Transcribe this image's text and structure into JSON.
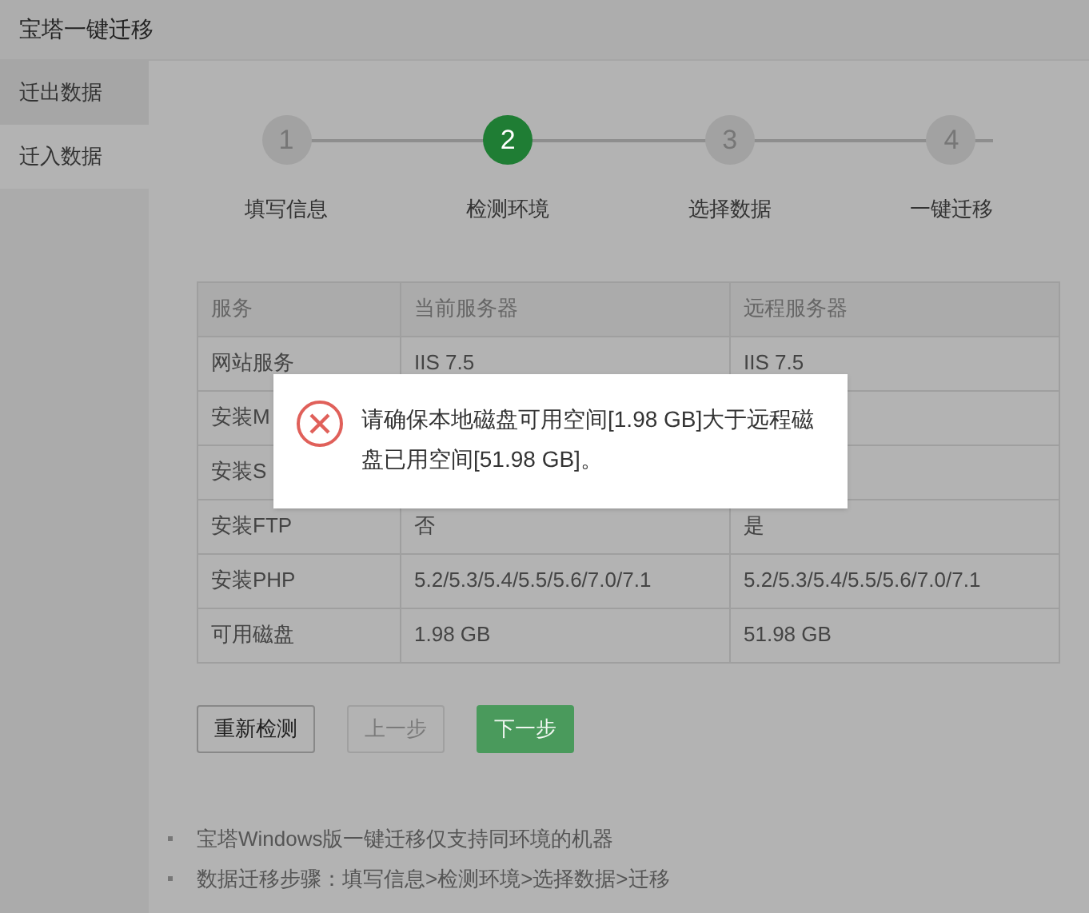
{
  "window": {
    "title": "宝塔一键迁移"
  },
  "sidebar": {
    "items": [
      {
        "label": "迁出数据",
        "selected": false
      },
      {
        "label": "迁入数据",
        "selected": true
      }
    ]
  },
  "steps": [
    {
      "number": "1",
      "label": "填写信息",
      "selected": false
    },
    {
      "number": "2",
      "label": "检测环境",
      "selected": true
    },
    {
      "number": "3",
      "label": "选择数据",
      "selected": false
    },
    {
      "number": "4",
      "label": "一键迁移",
      "selected": false
    }
  ],
  "table": {
    "columns": [
      "服务",
      "当前服务器",
      "远程服务器"
    ],
    "rows": [
      [
        "网站服务",
        "IIS 7.5",
        "IIS 7.5"
      ],
      [
        "安装M"
      ],
      [
        "安装S"
      ],
      [
        "安装FTP",
        "否",
        "是"
      ],
      [
        "安装PHP",
        "5.2/5.3/5.4/5.5/5.6/7.0/7.1",
        "5.2/5.3/5.4/5.5/5.6/7.0/7.1"
      ],
      [
        "可用磁盘",
        "1.98 GB",
        "51.98 GB"
      ]
    ]
  },
  "buttons": [
    {
      "label": "重新检测",
      "kind": "default",
      "disabled": false
    },
    {
      "label": "上一步",
      "kind": "default",
      "disabled": true
    },
    {
      "label": "下一步",
      "kind": "primary",
      "disabled": false
    }
  ],
  "notes": [
    "宝塔Windows版一键迁移仅支持同环境的机器",
    "数据迁移步骤：填写信息>检测环境>选择数据>迁移"
  ],
  "dialog": {
    "message": "请确保本地磁盘可用空间[1.98 GB]大于远程磁盘已用空间[51.98 GB]。"
  }
}
